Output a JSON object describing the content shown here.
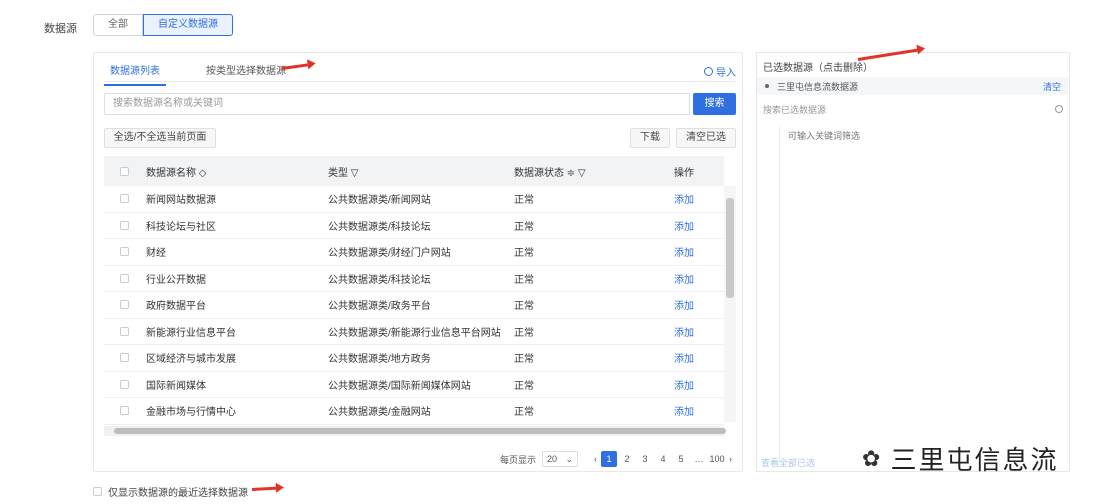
{
  "form": {
    "label": "数据源"
  },
  "mode_switch": {
    "option1": "全部",
    "option2": "自定义数据源"
  },
  "tabs": {
    "tab1": "数据源列表",
    "tab2": "按类型选择数据源"
  },
  "import_label": "导入",
  "search": {
    "placeholder": "搜索数据源名称或关键词",
    "button": "搜索"
  },
  "toolbar": {
    "select_all": "全选/不全选当前页面",
    "download": "下载",
    "clear": "清空已选"
  },
  "table": {
    "headers": {
      "name": "数据源名称 ◇",
      "type": "类型 ▽",
      "status": "数据源状态 ≑ ▽",
      "action": "操作"
    },
    "rows": [
      {
        "name": "新闻网站数据源",
        "type": "公共数据源类/新闻网站",
        "status": "正常",
        "action": "添加"
      },
      {
        "name": "科技论坛与社区",
        "type": "公共数据源类/科技论坛",
        "status": "正常",
        "action": "添加"
      },
      {
        "name": "财经",
        "type": "公共数据源类/财经门户网站",
        "status": "正常",
        "action": "添加"
      },
      {
        "name": "行业公开数据",
        "type": "公共数据源类/科技论坛",
        "status": "正常",
        "action": "添加"
      },
      {
        "name": "政府数据平台",
        "type": "公共数据源类/政务平台",
        "status": "正常",
        "action": "添加"
      },
      {
        "name": "新能源行业信息平台",
        "type": "公共数据源类/新能源行业信息平台网站",
        "status": "正常",
        "action": "添加"
      },
      {
        "name": "区域经济与城市发展",
        "type": "公共数据源类/地方政务",
        "status": "正常",
        "action": "添加"
      },
      {
        "name": "国际新闻媒体",
        "type": "公共数据源类/国际新闻媒体网站",
        "status": "正常",
        "action": "添加"
      },
      {
        "name": "金融市场与行情中心",
        "type": "公共数据源类/金融网站",
        "status": "正常",
        "action": "添加"
      }
    ]
  },
  "pagination": {
    "per_page_label": "每页显示",
    "per_page_value": "20",
    "pages": [
      "1",
      "2",
      "3",
      "4",
      "5",
      "…",
      "100"
    ]
  },
  "selected": {
    "title": "已选数据源（点击删除）",
    "item": "三里屯信息流数据源",
    "clear": "清空",
    "search_placeholder": "搜索已选数据源",
    "hint": "可输入关键词筛选",
    "footer_link": "查看全部已选"
  },
  "bottom_checkbox": "仅显示数据源的最近选择数据源",
  "watermark": "三里屯信息流",
  "colors": {
    "accent": "#2f6fe0",
    "arrow": "#e03428"
  }
}
